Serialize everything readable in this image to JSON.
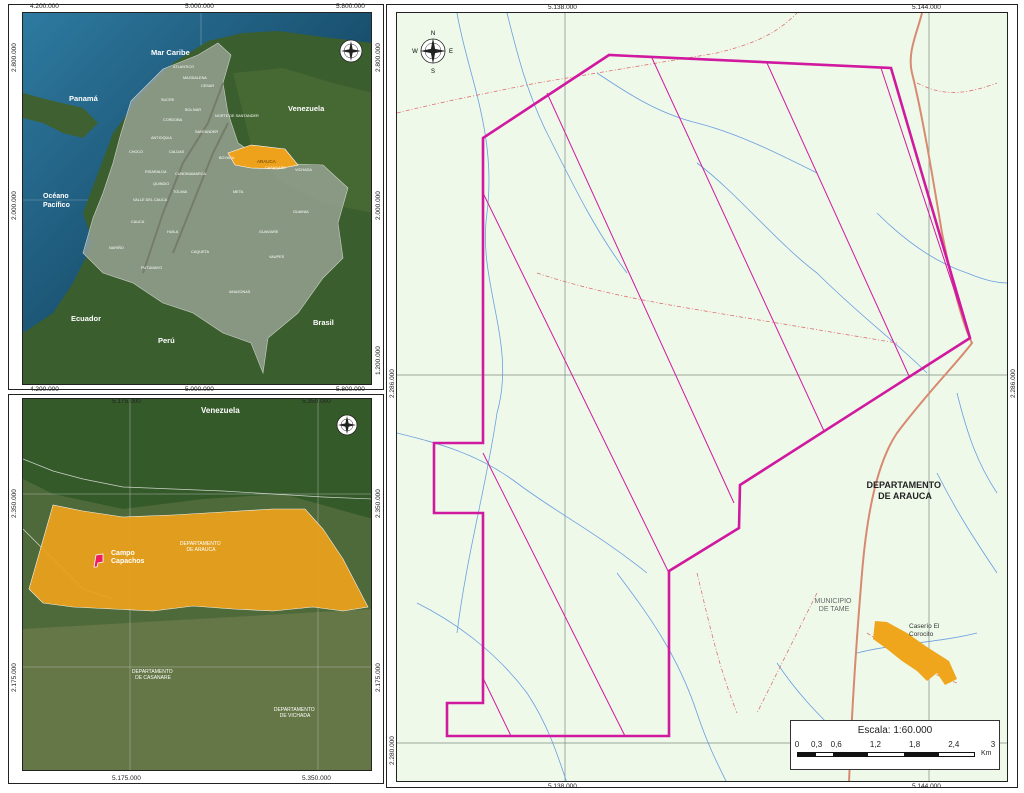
{
  "panel_colombia": {
    "ticks_top": [
      "4.200.000",
      "5.000.000",
      "5.800.000"
    ],
    "ticks_bottom": [
      "4.200.000",
      "5.000.000",
      "5.800.000"
    ],
    "ticks_left": [
      "2.800.000",
      "2.000.000",
      "1.200.000"
    ],
    "ticks_right": [
      "2.800.000",
      "2.000.000",
      "1.200.000"
    ],
    "labels": {
      "mar_caribe": "Mar Caribe",
      "panama": "Panamá",
      "venezuela": "Venezuela",
      "oceano_pacifico": "Océano\nPacífico",
      "ecuador": "Ecuador",
      "peru": "Perú",
      "brasil": "Brasil",
      "arauca": "ARAUCA"
    },
    "departments": [
      "ATLANTICO",
      "MAGDALENA",
      "CESAR",
      "SUCRE",
      "BOLIVAR",
      "CORDOBA",
      "NORTE DE SANTANDER",
      "ANTIOQUIA",
      "SANTANDER",
      "CHOCO",
      "CALDAS",
      "BOYACA",
      "CASANARE",
      "VICHADA",
      "CUNDINAMARCA",
      "RISARALDA",
      "QUINDIO",
      "TOLIMA",
      "VALLE DEL CAUCA",
      "META",
      "GUAINIA",
      "CAUCA",
      "HUILA",
      "GUAVIARE",
      "NARIÑO",
      "CAQUETA",
      "VAUPES",
      "PUTUMAYO",
      "AMAZONAS"
    ]
  },
  "panel_arauca": {
    "ticks_top": [
      "5.175.000",
      "5.350.000"
    ],
    "ticks_bottom": [
      "5.175.000",
      "5.350.000"
    ],
    "ticks_left": [
      "2.350.000",
      "2.175.000"
    ],
    "ticks_right": [
      "2.350.000",
      "2.175.000"
    ],
    "labels": {
      "venezuela": "Venezuela",
      "campo": "Campo\nCapachos",
      "dep_arauca": "DEPARTAMENTO\nDE ARAUCA",
      "dep_casanare": "DEPARTAMENTO\nDE CASANARE",
      "dep_vichada": "DEPARTAMENTO\nDE VICHADA"
    }
  },
  "panel_detail": {
    "ticks_top": [
      "5.138.000",
      "5.144.000"
    ],
    "ticks_bottom": [
      "5.138.000",
      "5.144.000"
    ],
    "ticks_left": [
      "2.286.000",
      "2.280.000"
    ],
    "ticks_right": [
      "2.286.000",
      "2.280.000"
    ],
    "labels": {
      "dep_arauca": "DEPARTAMENTO\nDE ARAUCA",
      "municipio": "MUNICIPIO\nDE TAME",
      "caserio": "Caserío El\nCorocito"
    },
    "scale": {
      "title": "Escala: 1:60.000",
      "ticks": [
        "0",
        "0,3",
        "0,6",
        "1,2",
        "1,8",
        "2,4",
        "3"
      ],
      "unit": "Km"
    }
  },
  "compass": {
    "n": "N",
    "s": "S",
    "e": "E",
    "w": "W"
  },
  "colors": {
    "polygon": "#d1199f",
    "arauca_fill": "#eea21c",
    "road": "#d88a70",
    "rivers": "#6a9ee0"
  }
}
